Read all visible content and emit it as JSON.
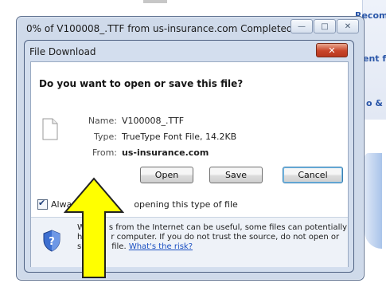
{
  "background": {
    "links": [
      "Recom",
      "ent f",
      "o &"
    ]
  },
  "progress_window": {
    "title": "0% of V100008_.TTF from us-insurance.com Completed",
    "minimize": "—",
    "maximize": "□",
    "close": "✕"
  },
  "dialog": {
    "title": "File Download",
    "close": "✕",
    "question": "Do you want to open or save this file?",
    "name_label": "Name:",
    "name_value": "V100008_.TTF",
    "type_label": "Type:",
    "type_value": "TrueType Font File, 14.2KB",
    "from_label": "From:",
    "from_value": "us-insurance.com",
    "buttons": {
      "open": "Open",
      "save": "Save",
      "cancel": "Cancel"
    },
    "checkbox_label_start": "Alwa",
    "checkbox_label_end": "opening this type of file",
    "warning_line1_start": "W",
    "warning_line1_end": "s from the Internet can be useful, some files can potentially",
    "warning_line2_start": "h",
    "warning_line2_end": "r computer. If you do not trust the source, do not open or",
    "warning_line3_start": "s",
    "warning_line3_end": "file.",
    "risk_link": "What's the risk?"
  },
  "colors": {
    "arrow_fill": "#ffff00",
    "close_button": "#c8452a",
    "link": "#1a4fc1"
  },
  "icons": [
    "file-icon",
    "shield-icon",
    "checkbox-checked-icon",
    "up-arrow-annotation"
  ]
}
